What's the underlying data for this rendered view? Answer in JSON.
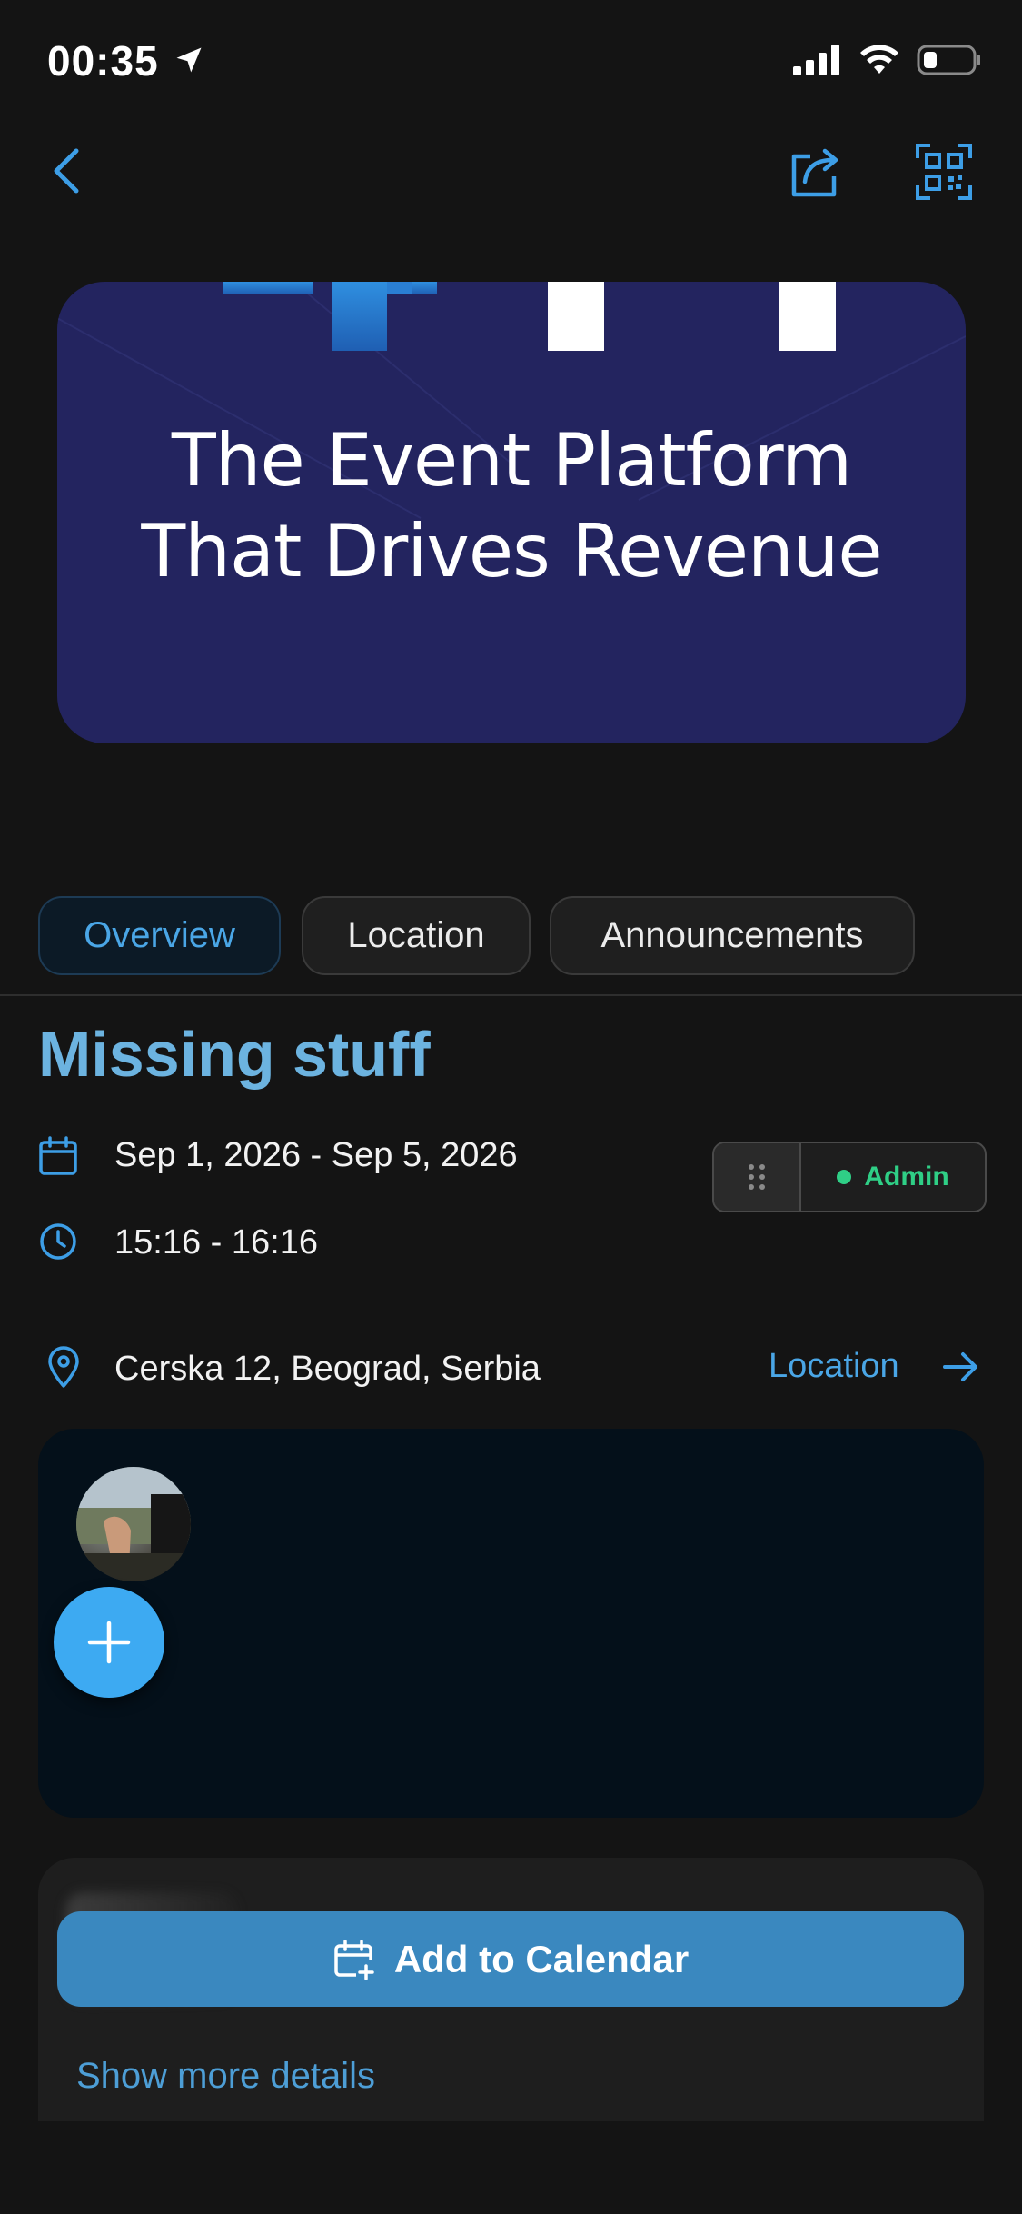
{
  "status_bar": {
    "time": "00:35"
  },
  "hero": {
    "line1": "The Event Platform",
    "line2": "That Drives Revenue"
  },
  "tabs": [
    {
      "label": "Overview",
      "active": true
    },
    {
      "label": "Location",
      "active": false
    },
    {
      "label": "Announcements",
      "active": false
    }
  ],
  "event": {
    "title": "Missing stuff",
    "date_range": "Sep 1, 2026 - Sep 5, 2026",
    "time_range": "15:16 - 16:16",
    "address": "Cerska 12, Beograd, Serbia"
  },
  "role": {
    "label": "Admin",
    "status_color": "#2fcf86"
  },
  "location_link": "Location",
  "add_to_calendar": "Add to Calendar",
  "show_more": "Show more details",
  "colors": {
    "accent": "#4aa6e6",
    "title": "#6cb3e0",
    "button": "#3a88bf",
    "fab": "#3daaf2",
    "hero_bg": "#23245f"
  },
  "icons": {
    "back": "chevron-left-icon",
    "share": "share-icon",
    "qr": "qr-code-icon",
    "calendar": "calendar-icon",
    "clock": "clock-icon",
    "pin": "map-pin-icon",
    "arrow": "arrow-right-icon",
    "grip": "drag-handle-icon",
    "add": "plus-icon",
    "calendar_add": "calendar-add-icon"
  }
}
